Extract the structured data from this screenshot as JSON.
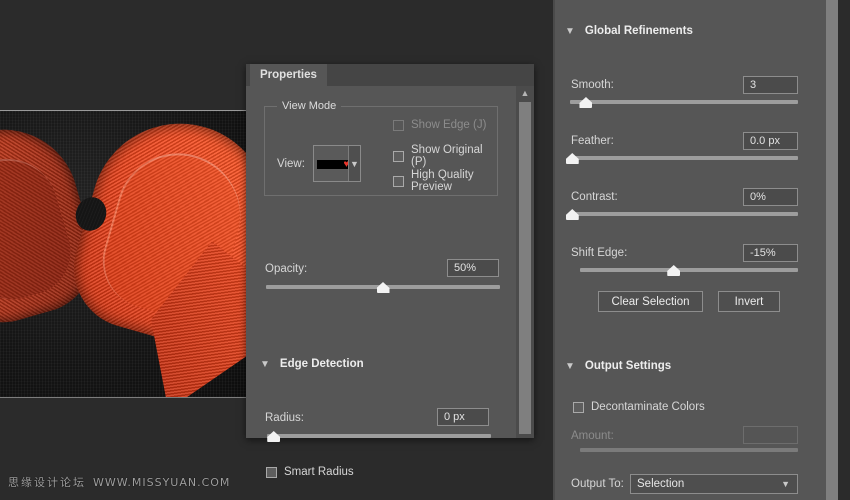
{
  "colors": {
    "panel_bg": "#565656",
    "panel_tabbar": "#454545",
    "field_bg": "#4b4b4b",
    "canvas_bg": "#2b2b2b",
    "slider_track": "#9d9d9d",
    "knob": "#f2f2f2",
    "text": "#d6d6d6",
    "text_dim": "#8c8c8c",
    "heart_red": "#e8342a"
  },
  "canvas": {
    "watermark_cn": "思缘设计论坛",
    "watermark_url": "WWW.MISSYUAN.COM",
    "image_alt": "knitted-red-heart-on-dark-fabric"
  },
  "properties_panel": {
    "tab_label": "Properties",
    "scrollbar_up_icon": "chevron-up-icon",
    "view_mode": {
      "group_title": "View Mode",
      "view_label": "View:",
      "view_swatch_icon": "black-matte-swatch-with-heart",
      "dropdown_icon": "chevron-down-icon",
      "checkboxes": [
        {
          "label": "Show Edge (J)",
          "checked": false,
          "enabled": false
        },
        {
          "label": "Show Original (P)",
          "checked": false,
          "enabled": true
        },
        {
          "label": "High Quality Preview",
          "checked": false,
          "enabled": true
        }
      ]
    },
    "opacity": {
      "label": "Opacity:",
      "value": "50%",
      "slider_percent": 50
    },
    "edge_detection": {
      "section_title": "Edge Detection",
      "collapse_icon": "chevron-down-icon",
      "radius": {
        "label": "Radius:",
        "value": "0 px",
        "slider_percent": 0
      },
      "smart_radius": {
        "label": "Smart Radius",
        "checked": false
      }
    }
  },
  "right_panel": {
    "global_refinements": {
      "section_title": "Global Refinements",
      "collapse_icon": "chevron-down-icon",
      "sliders": [
        {
          "name": "smooth",
          "label": "Smooth:",
          "value": "3",
          "slider_percent": 7,
          "indented": false
        },
        {
          "name": "feather",
          "label": "Feather:",
          "value": "0.0 px",
          "slider_percent": 0,
          "indented": false
        },
        {
          "name": "contrast",
          "label": "Contrast:",
          "value": "0%",
          "slider_percent": 0,
          "indented": false
        },
        {
          "name": "shift-edge",
          "label": "Shift Edge:",
          "value": "-15%",
          "slider_percent": 43,
          "indented": true
        }
      ],
      "buttons": [
        {
          "name": "clear-selection",
          "label": "Clear Selection"
        },
        {
          "name": "invert",
          "label": "Invert"
        }
      ]
    },
    "output_settings": {
      "section_title": "Output Settings",
      "collapse_icon": "chevron-down-icon",
      "decontaminate": {
        "label": "Decontaminate Colors",
        "checked": false
      },
      "amount": {
        "label": "Amount:",
        "value": "",
        "slider_percent": 0,
        "enabled": false
      },
      "output_to": {
        "label": "Output To:",
        "value": "Selection",
        "dropdown_icon": "chevron-down-icon"
      }
    }
  }
}
